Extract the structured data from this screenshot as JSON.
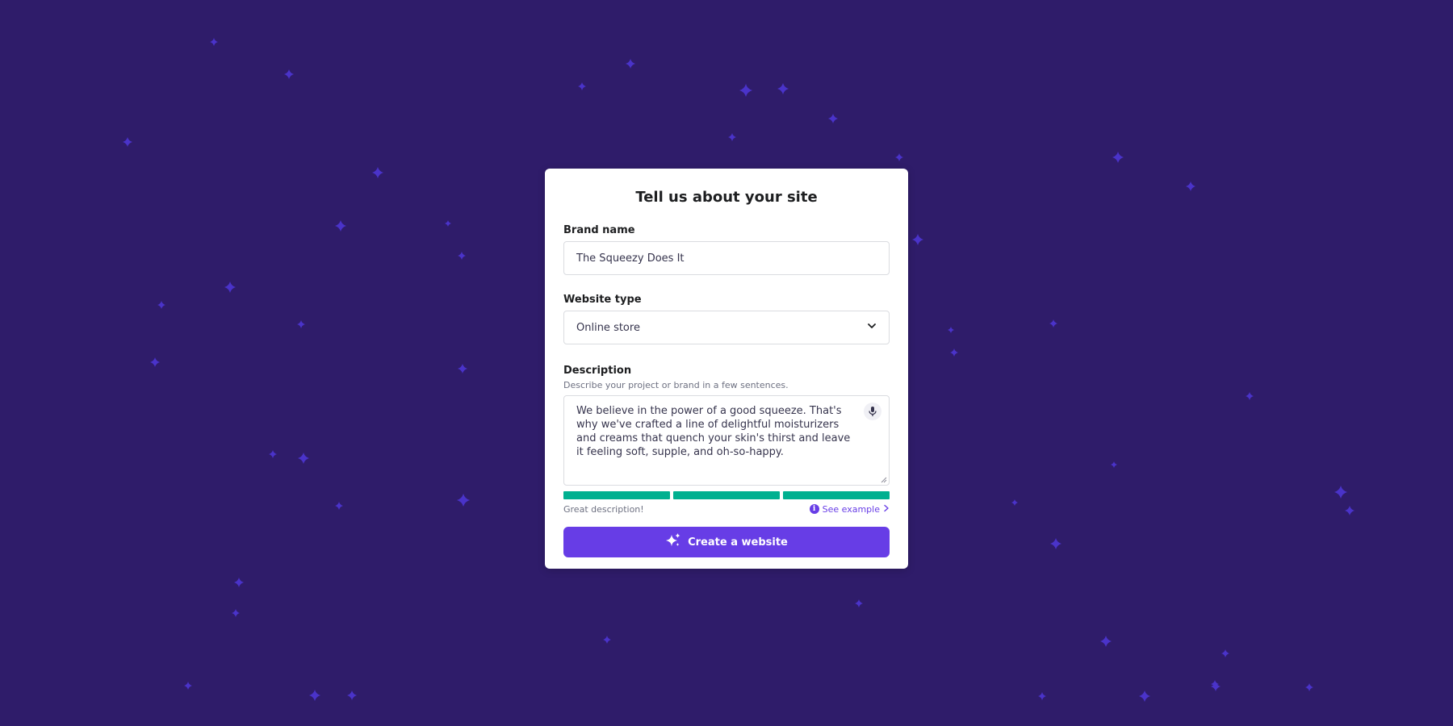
{
  "colors": {
    "background": "#2f1c6a",
    "star": "#4a33c9",
    "accent": "#673de6",
    "success": "#00b090"
  },
  "form": {
    "title": "Tell us about your site",
    "brand_label": "Brand name",
    "brand_value": "The Squeezy Does It",
    "type_label": "Website type",
    "type_value": "Online store",
    "description_label": "Description",
    "description_helper": "Describe your project or brand in a few sentences.",
    "description_value": "We believe in the power of a good squeeze. That's why we've crafted a line of delightful moisturizers and creams that quench your skin's thirst and leave it feeling soft, supple, and oh-so-happy.",
    "strength_level": 3,
    "strength_max": 3,
    "strength_text": "Great description!",
    "see_example_label": "See example",
    "create_button_label": "Create a website"
  },
  "icons": {
    "dropdown": "chevron-down-icon",
    "microphone": "microphone-icon",
    "info": "info-icon",
    "see_example_arrow": "chevron-right-icon",
    "create_button": "sparkles-icon",
    "background_decoration": "sparkle-star-icon"
  }
}
